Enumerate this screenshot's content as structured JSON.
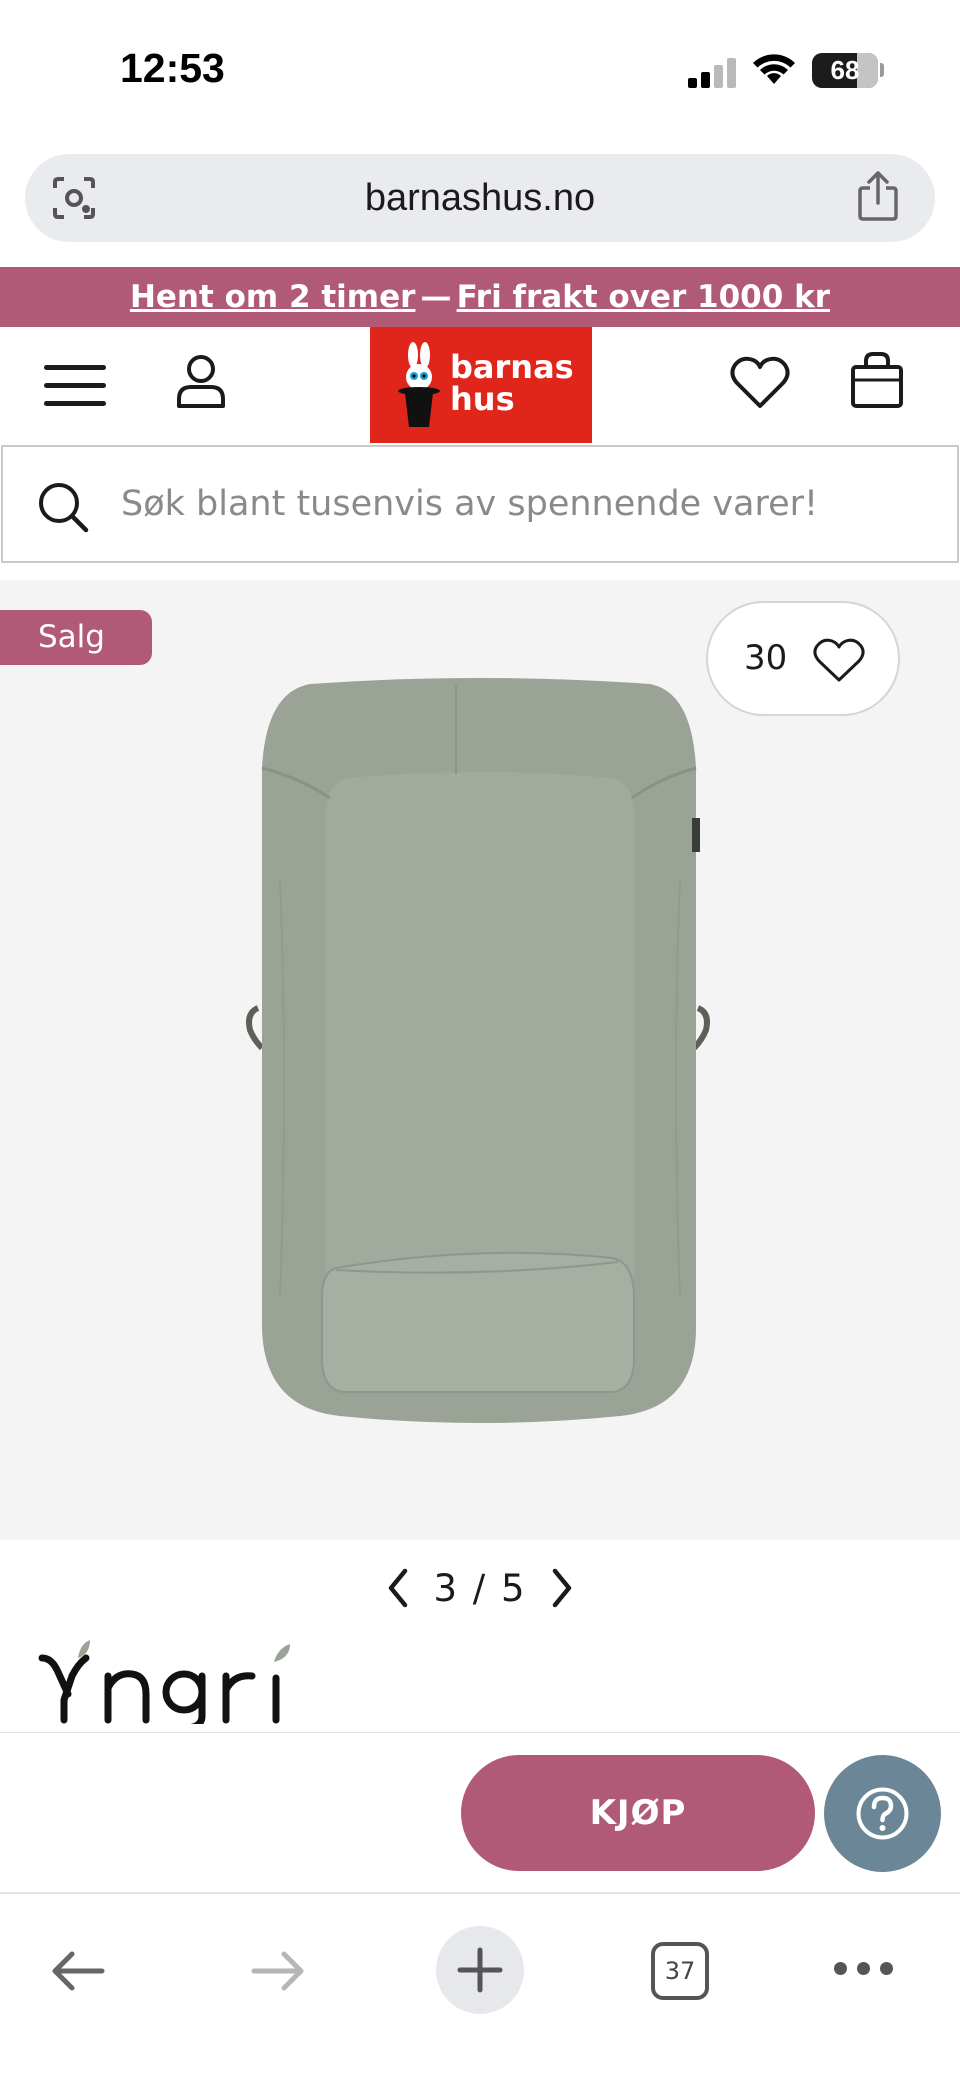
{
  "status_bar": {
    "time": "12:53",
    "battery": "68",
    "battery_level": 0.68
  },
  "browser": {
    "url": "barnashus.no",
    "tab_count": "37"
  },
  "promo": {
    "pickup_text": "Hent om 2 timer",
    "separator": "—",
    "shipping_text": "Fri frakt over 1000 kr"
  },
  "header": {
    "logo_line1": "barnas",
    "logo_line2": "hus"
  },
  "search": {
    "placeholder": "Søk blant tusenvis av spennende varer!"
  },
  "product": {
    "badge": "Salg",
    "favorites_count": "30",
    "image_index": "3",
    "image_total": "5",
    "image_separator": "/",
    "brand": "Yngri",
    "product_color": "#9aa395"
  },
  "actions": {
    "buy_label": "KJØP",
    "help_label": "?"
  },
  "colors": {
    "accent": "#b05a78",
    "logo_red": "#e0251b",
    "help_blue": "#6b8797"
  }
}
